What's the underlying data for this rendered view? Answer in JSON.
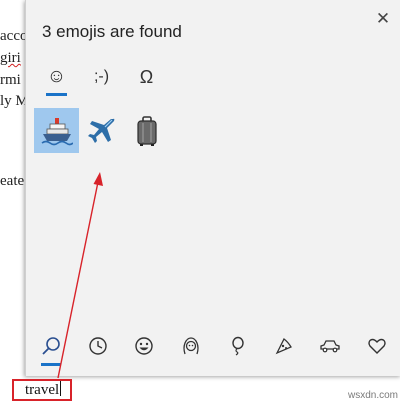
{
  "document": {
    "lines": [
      "acco",
      "giri",
      "rmi",
      "ly M",
      "eate"
    ]
  },
  "panel": {
    "title": "3 emojis are found",
    "close_icon": "close-icon",
    "tabs": [
      {
        "label": "☺",
        "icon": "smiley-tab-icon",
        "active": true
      },
      {
        "label": ";-)",
        "icon": "kaomoji-tab-icon",
        "active": false
      },
      {
        "label": "Ω",
        "icon": "symbols-tab-icon",
        "active": false
      }
    ],
    "results": [
      {
        "icon": "ship-icon",
        "selected": true
      },
      {
        "icon": "airplane-icon",
        "selected": false
      },
      {
        "icon": "luggage-icon",
        "selected": false
      }
    ],
    "categories": [
      {
        "icon": "search-icon",
        "active": true
      },
      {
        "icon": "clock-icon",
        "active": false
      },
      {
        "icon": "smiley-face-icon",
        "active": false
      },
      {
        "icon": "person-icon",
        "active": false
      },
      {
        "icon": "balloon-icon",
        "active": false
      },
      {
        "icon": "pizza-icon",
        "active": false
      },
      {
        "icon": "car-icon",
        "active": false
      },
      {
        "icon": "heart-icon",
        "active": false
      }
    ],
    "accent_color": "#1a73c8",
    "selected_color": "#9fc8ee"
  },
  "search": {
    "text": "travel",
    "highlight_color": "#d8232a"
  },
  "watermark": "wsxdn.com"
}
